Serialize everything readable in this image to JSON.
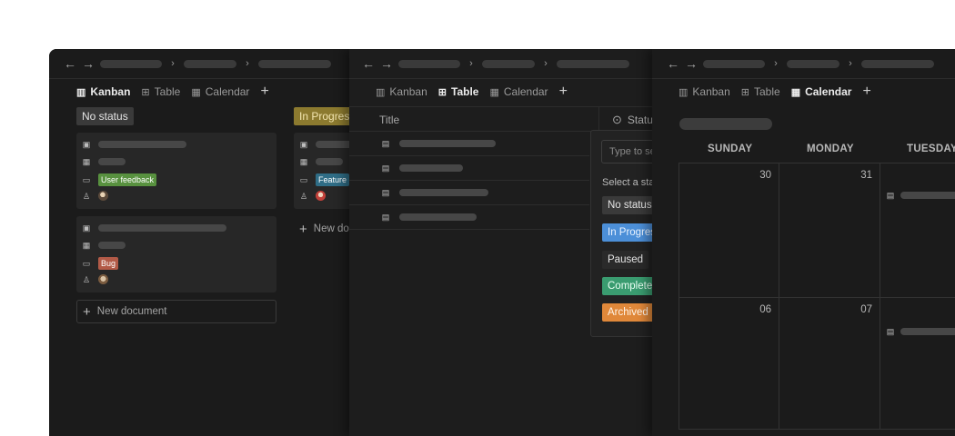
{
  "tabs": {
    "kanban": "Kanban",
    "table": "Table",
    "calendar": "Calendar",
    "add": "+"
  },
  "nav": {
    "back": "←",
    "forward": "→",
    "separator": "›"
  },
  "kanban": {
    "columns": [
      {
        "label": "No status",
        "color": "#3a3a3a"
      },
      {
        "label": "In Progress",
        "color": "#8c7a2f"
      }
    ],
    "cards": [
      {
        "tag": "User feedback",
        "tag_color": "#58913f"
      },
      {
        "tag": "Bug",
        "tag_color": "#b25a47"
      },
      {
        "tag": "Feature",
        "tag_color": "#2f6d86"
      }
    ],
    "new_document": "New document"
  },
  "table": {
    "headers": {
      "title": "Title",
      "status": "Status"
    },
    "row_count": 4,
    "dropdown": {
      "placeholder": "Type to search",
      "label": "Select a status",
      "options": [
        {
          "label": "No status",
          "color": "#3a3a3a"
        },
        {
          "label": "In Progress",
          "color": "#4c8fd8"
        },
        {
          "label": "Paused",
          "color": "#2a2a2a"
        },
        {
          "label": "Completed",
          "color": "#3a9c70"
        },
        {
          "label": "Archived",
          "color": "#e0883a"
        }
      ]
    }
  },
  "calendar": {
    "days": [
      "SUNDAY",
      "MONDAY",
      "TUESDAY"
    ],
    "week1": [
      "30",
      "31",
      ""
    ],
    "week2": [
      "06",
      "07",
      ""
    ]
  },
  "colors": {
    "background": "#1b1b1b",
    "border": "#2c2c2c",
    "skeleton": "#474747"
  }
}
